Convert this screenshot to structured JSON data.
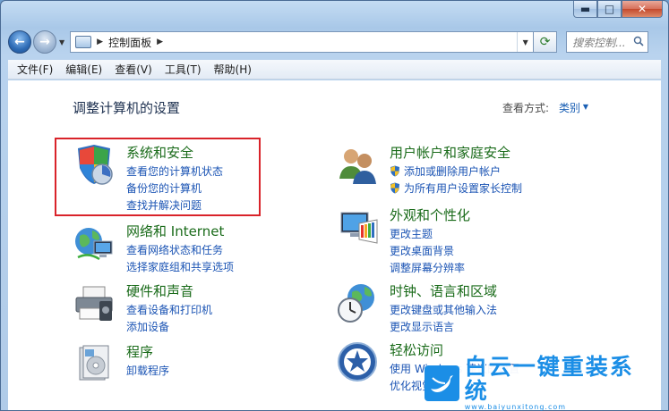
{
  "window": {
    "min_glyph": "▬",
    "max_glyph": "□",
    "close_glyph": "✕"
  },
  "nav": {
    "back_glyph": "←",
    "forward_glyph": "→",
    "dropdown_glyph": "▼",
    "address_sep": "▶",
    "address_text": "控制面板",
    "address_trail": "▶",
    "refresh_glyph": "⟳",
    "search_placeholder": "搜索控制..."
  },
  "menubar": [
    "文件(F)",
    "编辑(E)",
    "查看(V)",
    "工具(T)",
    "帮助(H)"
  ],
  "content": {
    "title": "调整计算机的设置",
    "view_by_label": "查看方式:",
    "view_by_value": "类别",
    "view_by_arrow": "▼"
  },
  "categories": [
    {
      "title": "系统和安全",
      "links": [
        "查看您的计算机状态",
        "备份您的计算机",
        "查找并解决问题"
      ],
      "icon": "shield-security-icon"
    },
    {
      "title": "网络和 Internet",
      "links": [
        "查看网络状态和任务",
        "选择家庭组和共享选项"
      ],
      "icon": "network-globe-icon"
    },
    {
      "title": "硬件和声音",
      "links": [
        "查看设备和打印机",
        "添加设备"
      ],
      "icon": "printer-icon"
    },
    {
      "title": "程序",
      "links": [
        "卸载程序"
      ],
      "icon": "programs-icon"
    },
    {
      "title": "用户帐户和家庭安全",
      "links": [
        "添加或删除用户帐户",
        "为所有用户设置家长控制"
      ],
      "icon": "users-icon"
    },
    {
      "title": "外观和个性化",
      "links": [
        "更改主题",
        "更改桌面背景",
        "调整屏幕分辨率"
      ],
      "icon": "appearance-icon"
    },
    {
      "title": "时钟、语言和区域",
      "links": [
        "更改键盘或其他输入法",
        "更改显示语言"
      ],
      "icon": "clock-globe-icon"
    },
    {
      "title": "轻松访问",
      "links": [
        "使用 Windows 建议的设置",
        "优化视觉显示"
      ],
      "icon": "ease-of-access-icon"
    }
  ],
  "watermark": {
    "name": "白云一键重装系统",
    "url": "www.baiyunxitong.com"
  },
  "colors": {
    "accent": "#1b54b4",
    "category_title": "#1a6b1a",
    "highlight": "#d9232a"
  }
}
